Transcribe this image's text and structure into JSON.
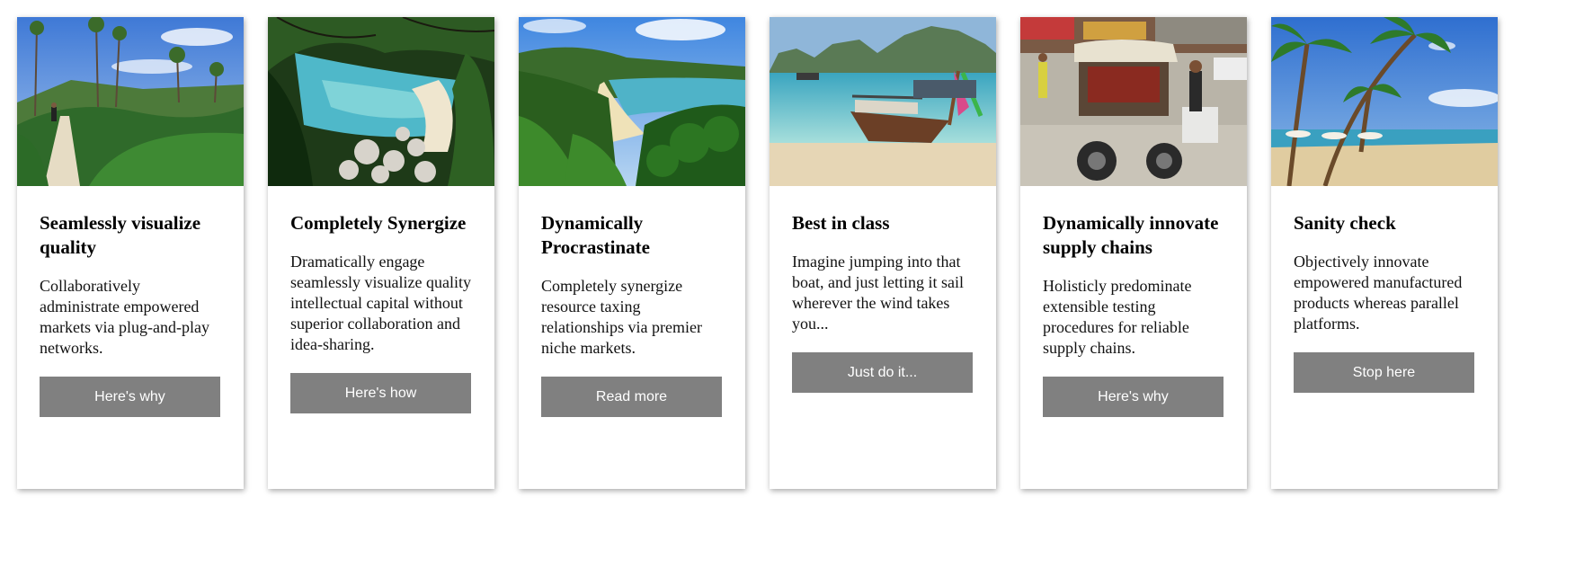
{
  "colors": {
    "button_bg": "#808080",
    "button_text": "#ffffff",
    "card_bg": "#ffffff"
  },
  "cards": [
    {
      "image": "forest-trail-beach-photo",
      "title": "Seamlessly visualize quality",
      "text": "Collaboratively administrate empowered markets via plug-and-play networks.",
      "button": "Here's why"
    },
    {
      "image": "rocky-cove-beach-photo",
      "title": "Completely Synergize",
      "text": "Dramatically engage seamlessly visualize quality intellectual capital without superior collaboration and idea-sharing.",
      "button": "Here's how"
    },
    {
      "image": "fern-bay-beach-photo",
      "title": "Dynamically Procrastinate",
      "text": "Completely synergize resource taxing relationships via premier niche markets.",
      "button": "Read more"
    },
    {
      "image": "longtail-boat-beach-photo",
      "title": "Best in class",
      "text": "Imagine jumping into that boat, and just letting it sail wherever the wind takes you...",
      "button": "Just do it..."
    },
    {
      "image": "tuk-tuk-street-market-photo",
      "title": "Dynamically innovate supply chains",
      "text": "Holisticly predominate extensible testing procedures for reliable supply chains.",
      "button": "Here's why"
    },
    {
      "image": "palm-tree-beach-photo",
      "title": "Sanity check",
      "text": "Objectively innovate empowered manufactured products whereas parallel platforms.",
      "button": "Stop here"
    }
  ]
}
